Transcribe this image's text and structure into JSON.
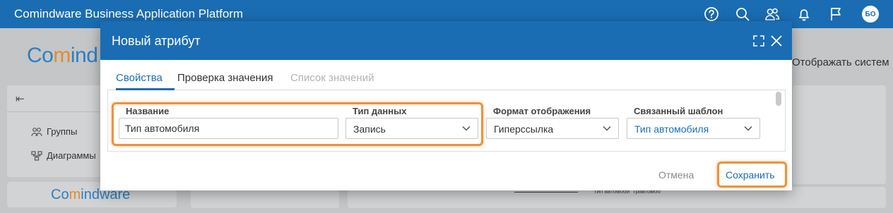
{
  "app": {
    "title": "Comindware Business Application Platform",
    "avatar_initials": "БО",
    "icons": [
      "help-icon",
      "search-icon",
      "users-icon",
      "bell-icon",
      "flag-icon"
    ]
  },
  "background": {
    "logo_prefix": "Co",
    "logo_highlight": "m",
    "logo_rest": "ind",
    "display_button": "Отображать систем",
    "sidebar_items": [
      {
        "label": "Группы",
        "icon": "groups-icon"
      },
      {
        "label": "Диаграммы",
        "icon": "diagram-icon"
      }
    ],
    "logo2_prefix": "Co",
    "logo2_highlight": "m",
    "logo2_rest": "indware",
    "diagram_labels": [
      "Тип автомоби",
      "Травтомоб"
    ]
  },
  "dialog": {
    "title": "Новый атрибут",
    "tabs": [
      {
        "label": "Свойства",
        "state": "active"
      },
      {
        "label": "Проверка значения",
        "state": "normal"
      },
      {
        "label": "Список значений",
        "state": "disabled"
      }
    ],
    "fields": {
      "name": {
        "label": "Название",
        "value": "Тип автомобиля"
      },
      "data_type": {
        "label": "Тип данных",
        "value": "Запись"
      },
      "display_format": {
        "label": "Формат отображения",
        "value": "Гиперссылка"
      },
      "linked_template": {
        "label": "Связанный шаблон",
        "value": "Тип автомобиля"
      }
    },
    "cancel_label": "Отмена",
    "save_label": "Сохранить"
  },
  "colors": {
    "primary": "#1a6db3",
    "highlight": "#f0913a",
    "logo_accent": "#e38b2f"
  }
}
